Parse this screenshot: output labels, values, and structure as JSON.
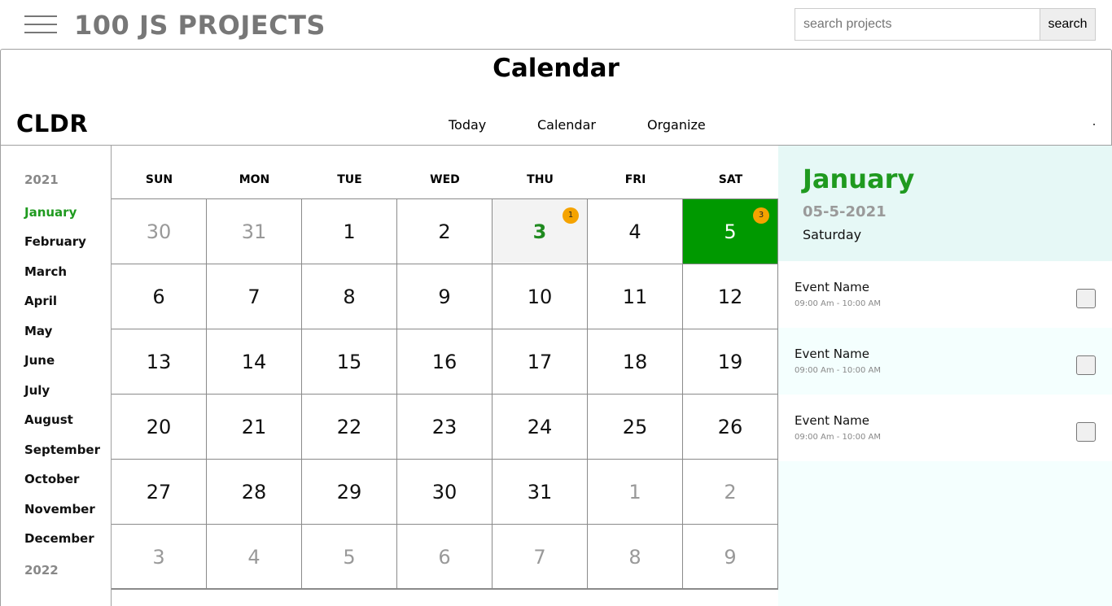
{
  "header": {
    "site_title": "100 JS PROJECTS",
    "search_placeholder": "search projects",
    "search_button": "search"
  },
  "page_title": "Calendar",
  "app": {
    "brand": "CLDR",
    "nav": [
      "Today",
      "Calendar",
      "Organize"
    ]
  },
  "sidebar": {
    "year_current": "2021",
    "year_next": "2022",
    "months": [
      "January",
      "February",
      "March",
      "April",
      "May",
      "June",
      "July",
      "August",
      "September",
      "October",
      "November",
      "December"
    ],
    "active_month": "January"
  },
  "calendar": {
    "weekdays": [
      "SUN",
      "MON",
      "TUE",
      "WED",
      "THU",
      "FRI",
      "SAT"
    ],
    "weeks": [
      [
        {
          "d": "30",
          "muted": true
        },
        {
          "d": "31",
          "muted": true
        },
        {
          "d": "1"
        },
        {
          "d": "2"
        },
        {
          "d": "3",
          "today": true,
          "badge": "1"
        },
        {
          "d": "4"
        },
        {
          "d": "5",
          "selected": true,
          "badge": "3"
        }
      ],
      [
        {
          "d": "6"
        },
        {
          "d": "7"
        },
        {
          "d": "8"
        },
        {
          "d": "9"
        },
        {
          "d": "10"
        },
        {
          "d": "11"
        },
        {
          "d": "12"
        }
      ],
      [
        {
          "d": "13"
        },
        {
          "d": "14"
        },
        {
          "d": "15"
        },
        {
          "d": "16"
        },
        {
          "d": "17"
        },
        {
          "d": "18"
        },
        {
          "d": "19"
        }
      ],
      [
        {
          "d": "20"
        },
        {
          "d": "21"
        },
        {
          "d": "22"
        },
        {
          "d": "23"
        },
        {
          "d": "24"
        },
        {
          "d": "25"
        },
        {
          "d": "26"
        }
      ],
      [
        {
          "d": "27"
        },
        {
          "d": "28"
        },
        {
          "d": "29"
        },
        {
          "d": "30"
        },
        {
          "d": "31"
        },
        {
          "d": "1",
          "muted": true
        },
        {
          "d": "2",
          "muted": true
        }
      ],
      [
        {
          "d": "3",
          "muted": true
        },
        {
          "d": "4",
          "muted": true
        },
        {
          "d": "5",
          "muted": true
        },
        {
          "d": "6",
          "muted": true
        },
        {
          "d": "7",
          "muted": true
        },
        {
          "d": "8",
          "muted": true
        },
        {
          "d": "9",
          "muted": true
        }
      ]
    ]
  },
  "panel": {
    "month": "January",
    "date": "05-5-2021",
    "weekday": "Saturday",
    "events": [
      {
        "name": "Event Name",
        "time": "09:00 Am - 10:00 AM"
      },
      {
        "name": "Event Name",
        "time": "09:00 Am - 10:00 AM"
      },
      {
        "name": "Event Name",
        "time": "09:00 Am - 10:00 AM"
      }
    ]
  },
  "colors": {
    "accent_green": "#009900",
    "text_green": "#1f9a1f",
    "badge_orange": "#f5a300",
    "panel_bg": "#e6f8f6"
  }
}
